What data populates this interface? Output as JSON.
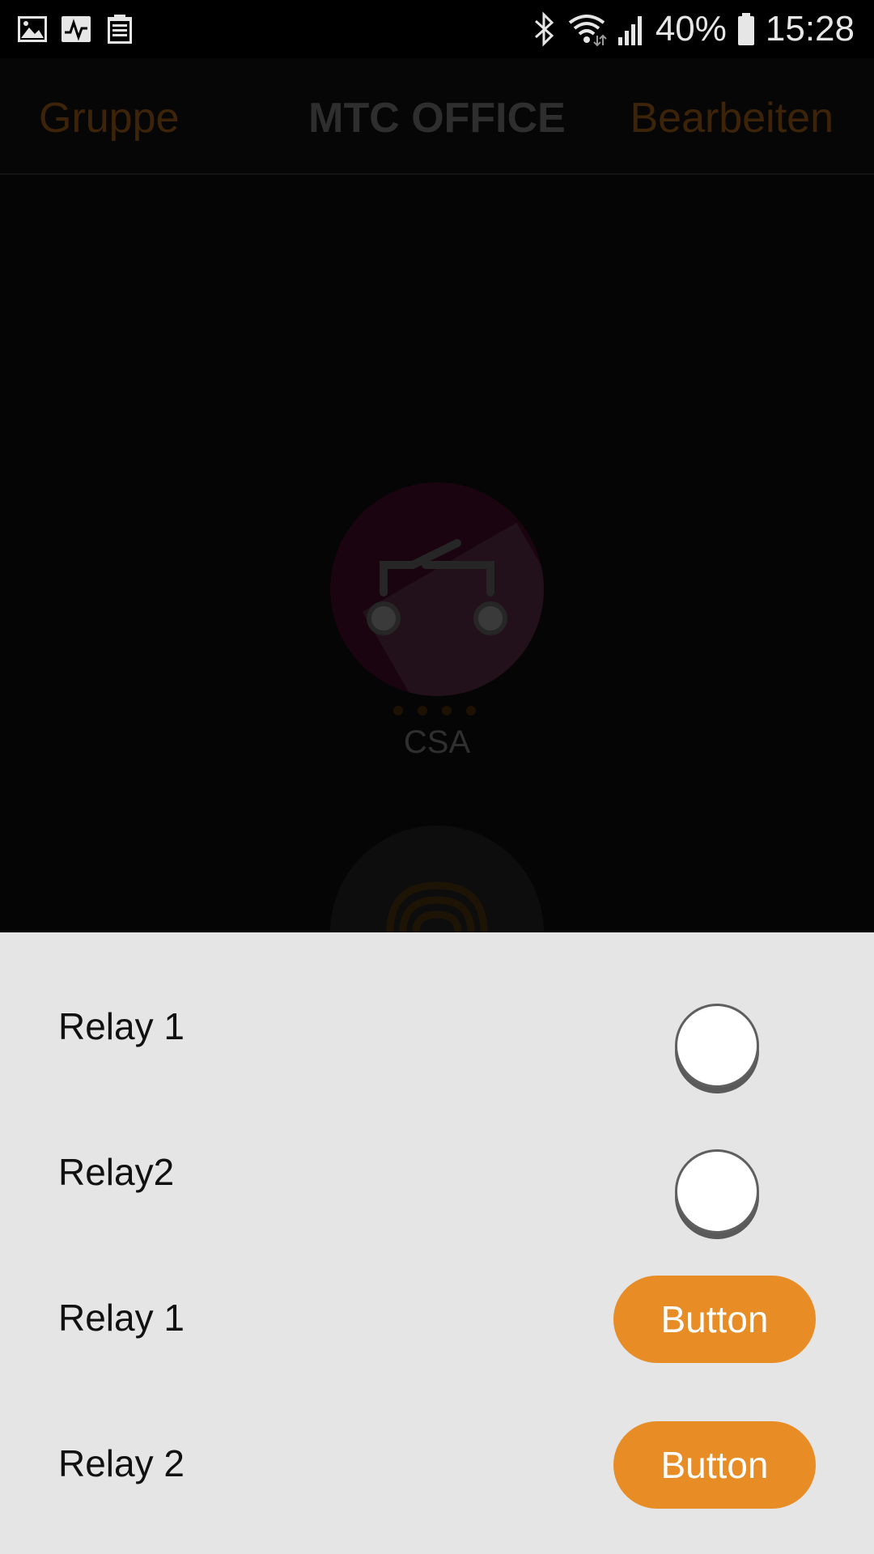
{
  "status_bar": {
    "left_icons": [
      "gallery-icon",
      "activity-icon",
      "clipboard-icon"
    ],
    "right_icons": [
      "bluetooth-icon",
      "wifi-icon",
      "signal-icon",
      "battery-icon"
    ],
    "battery": "40%",
    "time": "15:28"
  },
  "header": {
    "left_label": "Gruppe",
    "title": "MTC OFFICE",
    "right_label": "Bearbeiten",
    "accent_color": "#3d2409"
  },
  "device": {
    "icon": "relay-switch-icon",
    "label": "CSA",
    "dots": 4,
    "second_icon": "fingerprint-icon"
  },
  "sheet": {
    "background": "#e5e5e5",
    "rows": [
      {
        "label": "Relay 1",
        "control": "radio"
      },
      {
        "label": "Relay2",
        "control": "radio"
      },
      {
        "label": "Relay 1",
        "control": "button",
        "button_label": "Button"
      },
      {
        "label": "Relay 2",
        "control": "button",
        "button_label": "Button"
      }
    ],
    "button_color": "#e88c26"
  }
}
